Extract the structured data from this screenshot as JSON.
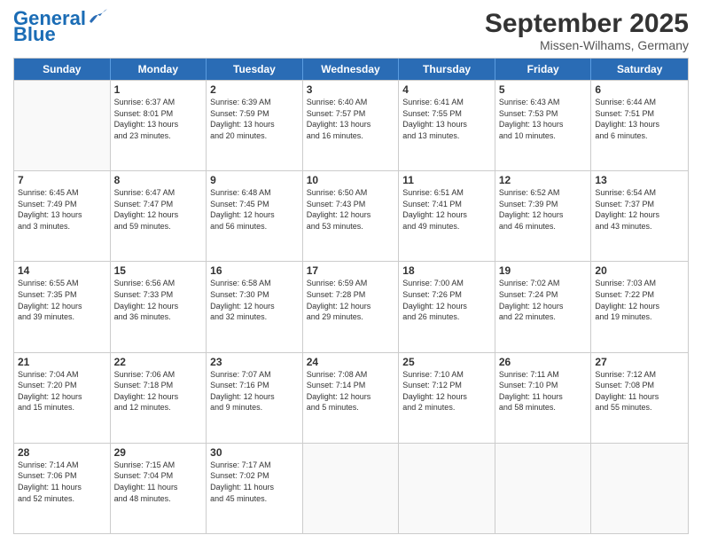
{
  "logo": {
    "line1": "General",
    "line2": "Blue"
  },
  "title": "September 2025",
  "subtitle": "Missen-Wilhams, Germany",
  "header_days": [
    "Sunday",
    "Monday",
    "Tuesday",
    "Wednesday",
    "Thursday",
    "Friday",
    "Saturday"
  ],
  "rows": [
    [
      {
        "day": "",
        "info": ""
      },
      {
        "day": "1",
        "info": "Sunrise: 6:37 AM\nSunset: 8:01 PM\nDaylight: 13 hours\nand 23 minutes."
      },
      {
        "day": "2",
        "info": "Sunrise: 6:39 AM\nSunset: 7:59 PM\nDaylight: 13 hours\nand 20 minutes."
      },
      {
        "day": "3",
        "info": "Sunrise: 6:40 AM\nSunset: 7:57 PM\nDaylight: 13 hours\nand 16 minutes."
      },
      {
        "day": "4",
        "info": "Sunrise: 6:41 AM\nSunset: 7:55 PM\nDaylight: 13 hours\nand 13 minutes."
      },
      {
        "day": "5",
        "info": "Sunrise: 6:43 AM\nSunset: 7:53 PM\nDaylight: 13 hours\nand 10 minutes."
      },
      {
        "day": "6",
        "info": "Sunrise: 6:44 AM\nSunset: 7:51 PM\nDaylight: 13 hours\nand 6 minutes."
      }
    ],
    [
      {
        "day": "7",
        "info": "Sunrise: 6:45 AM\nSunset: 7:49 PM\nDaylight: 13 hours\nand 3 minutes."
      },
      {
        "day": "8",
        "info": "Sunrise: 6:47 AM\nSunset: 7:47 PM\nDaylight: 12 hours\nand 59 minutes."
      },
      {
        "day": "9",
        "info": "Sunrise: 6:48 AM\nSunset: 7:45 PM\nDaylight: 12 hours\nand 56 minutes."
      },
      {
        "day": "10",
        "info": "Sunrise: 6:50 AM\nSunset: 7:43 PM\nDaylight: 12 hours\nand 53 minutes."
      },
      {
        "day": "11",
        "info": "Sunrise: 6:51 AM\nSunset: 7:41 PM\nDaylight: 12 hours\nand 49 minutes."
      },
      {
        "day": "12",
        "info": "Sunrise: 6:52 AM\nSunset: 7:39 PM\nDaylight: 12 hours\nand 46 minutes."
      },
      {
        "day": "13",
        "info": "Sunrise: 6:54 AM\nSunset: 7:37 PM\nDaylight: 12 hours\nand 43 minutes."
      }
    ],
    [
      {
        "day": "14",
        "info": "Sunrise: 6:55 AM\nSunset: 7:35 PM\nDaylight: 12 hours\nand 39 minutes."
      },
      {
        "day": "15",
        "info": "Sunrise: 6:56 AM\nSunset: 7:33 PM\nDaylight: 12 hours\nand 36 minutes."
      },
      {
        "day": "16",
        "info": "Sunrise: 6:58 AM\nSunset: 7:30 PM\nDaylight: 12 hours\nand 32 minutes."
      },
      {
        "day": "17",
        "info": "Sunrise: 6:59 AM\nSunset: 7:28 PM\nDaylight: 12 hours\nand 29 minutes."
      },
      {
        "day": "18",
        "info": "Sunrise: 7:00 AM\nSunset: 7:26 PM\nDaylight: 12 hours\nand 26 minutes."
      },
      {
        "day": "19",
        "info": "Sunrise: 7:02 AM\nSunset: 7:24 PM\nDaylight: 12 hours\nand 22 minutes."
      },
      {
        "day": "20",
        "info": "Sunrise: 7:03 AM\nSunset: 7:22 PM\nDaylight: 12 hours\nand 19 minutes."
      }
    ],
    [
      {
        "day": "21",
        "info": "Sunrise: 7:04 AM\nSunset: 7:20 PM\nDaylight: 12 hours\nand 15 minutes."
      },
      {
        "day": "22",
        "info": "Sunrise: 7:06 AM\nSunset: 7:18 PM\nDaylight: 12 hours\nand 12 minutes."
      },
      {
        "day": "23",
        "info": "Sunrise: 7:07 AM\nSunset: 7:16 PM\nDaylight: 12 hours\nand 9 minutes."
      },
      {
        "day": "24",
        "info": "Sunrise: 7:08 AM\nSunset: 7:14 PM\nDaylight: 12 hours\nand 5 minutes."
      },
      {
        "day": "25",
        "info": "Sunrise: 7:10 AM\nSunset: 7:12 PM\nDaylight: 12 hours\nand 2 minutes."
      },
      {
        "day": "26",
        "info": "Sunrise: 7:11 AM\nSunset: 7:10 PM\nDaylight: 11 hours\nand 58 minutes."
      },
      {
        "day": "27",
        "info": "Sunrise: 7:12 AM\nSunset: 7:08 PM\nDaylight: 11 hours\nand 55 minutes."
      }
    ],
    [
      {
        "day": "28",
        "info": "Sunrise: 7:14 AM\nSunset: 7:06 PM\nDaylight: 11 hours\nand 52 minutes."
      },
      {
        "day": "29",
        "info": "Sunrise: 7:15 AM\nSunset: 7:04 PM\nDaylight: 11 hours\nand 48 minutes."
      },
      {
        "day": "30",
        "info": "Sunrise: 7:17 AM\nSunset: 7:02 PM\nDaylight: 11 hours\nand 45 minutes."
      },
      {
        "day": "",
        "info": ""
      },
      {
        "day": "",
        "info": ""
      },
      {
        "day": "",
        "info": ""
      },
      {
        "day": "",
        "info": ""
      }
    ]
  ]
}
